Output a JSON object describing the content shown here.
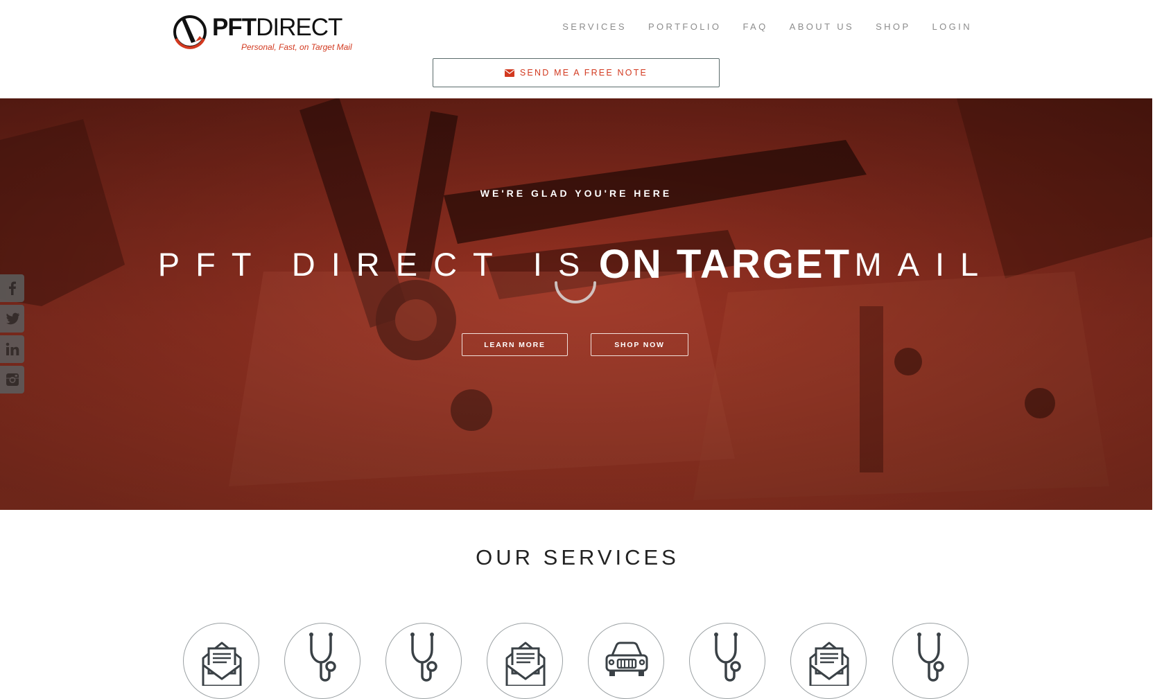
{
  "brand": {
    "name_bold": "PFT",
    "name_regular": "DIRECT",
    "tagline": "Personal, Fast, on Target Mail",
    "accent_color": "#d2391f"
  },
  "nav": {
    "items": [
      {
        "label": "SERVICES"
      },
      {
        "label": "PORTFOLIO"
      },
      {
        "label": "FAQ"
      },
      {
        "label": "ABOUT US"
      },
      {
        "label": "SHOP"
      },
      {
        "label": "LOGIN"
      }
    ]
  },
  "cta": {
    "label": "SEND ME A FREE NOTE",
    "icon": "envelope-icon"
  },
  "hero": {
    "kicker": "WE'RE GLAD YOU'RE HERE",
    "title_part1": "PFT DIRECT IS",
    "title_emphasis": "ON TARGET",
    "title_part2": "MAIL",
    "learn_more": "LEARN MORE",
    "shop_now": "SHOP NOW",
    "overlay_color": "#a83a27"
  },
  "social": {
    "items": [
      {
        "icon": "facebook-icon"
      },
      {
        "icon": "twitter-icon"
      },
      {
        "icon": "linkedin-icon"
      },
      {
        "icon": "instagram-icon"
      }
    ]
  },
  "services": {
    "title": "OUR SERVICES",
    "icons": [
      "envelope-letter-icon",
      "stethoscope-icon",
      "stethoscope-icon",
      "envelope-letter-icon",
      "car-icon",
      "stethoscope-icon",
      "envelope-letter-icon",
      "stethoscope-icon"
    ]
  }
}
